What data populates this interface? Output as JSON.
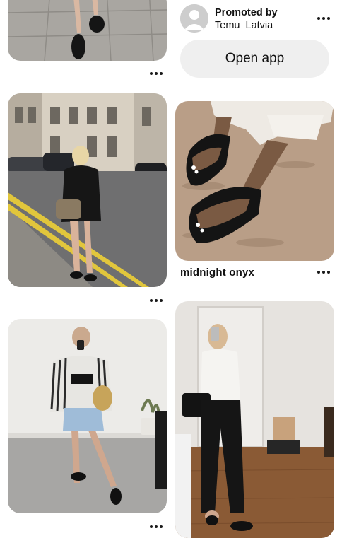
{
  "feed": {
    "promoted": {
      "label": "Promoted by",
      "advertiser": "Temu_Latvia",
      "cta_label": "Open app",
      "avatar_icon": "user-avatar-icon"
    },
    "pins": [
      {
        "id": "pin-1",
        "title": "",
        "image": "legs in black platform flip flops on paving stones"
      },
      {
        "id": "pin-2",
        "title": "",
        "image": "blonde woman in black outfit walking on city street"
      },
      {
        "id": "pin-3",
        "title": "midnight onyx",
        "image": "feet in black thong sandals on sand"
      },
      {
        "id": "pin-4",
        "title": "",
        "image": "mirror selfie in striped shirt and denim shorts"
      },
      {
        "id": "pin-5",
        "title": "",
        "image": "mirror selfie in white tank and black trousers"
      }
    ],
    "more_icon": "more-options-icon"
  },
  "colors": {
    "background": "#ffffff",
    "button_bg": "#efefef",
    "text": "#111111"
  }
}
